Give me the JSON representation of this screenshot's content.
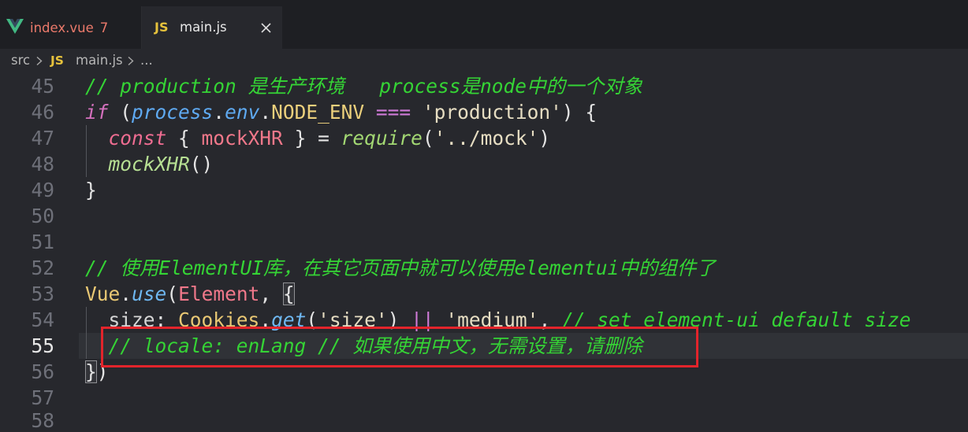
{
  "colors": {
    "editor_bg": "#27282d",
    "tab_bar_bg": "#1e1f23",
    "tab_error_text": "#ec7a6b",
    "js_icon": "#e6c23c",
    "vue_icon_primary": "#42b883",
    "vue_icon_secondary": "#35495e",
    "line_number": "#6e7079",
    "line_number_active": "#e6e6e6",
    "current_line_bg": "#303237",
    "indent_guide": "#54565c",
    "annotation_border": "#e3242b"
  },
  "tabs": [
    {
      "icon": "vue-icon",
      "label": "index.vue",
      "badge": "7"
    },
    {
      "icon": "js-icon",
      "icon_text": "JS",
      "label": "main.js",
      "close_icon": "close-icon"
    }
  ],
  "breadcrumb": {
    "separator_icon": "chevron-right-icon",
    "folder": "src",
    "file_icon": "JS",
    "file": "main.js",
    "more": "..."
  },
  "editor": {
    "lines": [
      {
        "number": "45",
        "tokens": [
          {
            "t": "// production 是生产环境   process是node中的一个对象",
            "c": "#35d435",
            "i": true
          }
        ]
      },
      {
        "number": "46",
        "tokens": [
          {
            "t": "if",
            "c": "#d470bd",
            "i": true
          },
          {
            "t": " (",
            "c": "#e4e4e4"
          },
          {
            "t": "process",
            "c": "#5faaf2",
            "i": true
          },
          {
            "t": ".",
            "c": "#e4e4e4"
          },
          {
            "t": "env",
            "c": "#5faaf2",
            "i": true
          },
          {
            "t": ".",
            "c": "#e4e4e4"
          },
          {
            "t": "NODE_ENV",
            "c": "#ecd07c"
          },
          {
            "t": " ",
            "c": "#e4e4e4"
          },
          {
            "t": "===",
            "c": "#d07bd8"
          },
          {
            "t": " ",
            "c": "#e4e4e4"
          },
          {
            "t": "'production'",
            "c": "#e6ddc2"
          },
          {
            "t": ") {",
            "c": "#e4e4e4"
          }
        ]
      },
      {
        "number": "47",
        "guide": true,
        "tokens": [
          {
            "t": "  ",
            "c": "#e4e4e4"
          },
          {
            "t": "const",
            "c": "#ef6d92",
            "i": true
          },
          {
            "t": " { ",
            "c": "#e4e4e4"
          },
          {
            "t": "mockXHR",
            "c": "#f0788a"
          },
          {
            "t": " } = ",
            "c": "#e4e4e4"
          },
          {
            "t": "require",
            "c": "#a3d873",
            "i": true
          },
          {
            "t": "(",
            "c": "#e4e4e4"
          },
          {
            "t": "'../mock'",
            "c": "#e6ddc2"
          },
          {
            "t": ")",
            "c": "#e4e4e4"
          }
        ]
      },
      {
        "number": "48",
        "guide": true,
        "tokens": [
          {
            "t": "  ",
            "c": "#e4e4e4"
          },
          {
            "t": "mockXHR",
            "c": "#b6df93",
            "i": true
          },
          {
            "t": "()",
            "c": "#e4e4e4"
          }
        ]
      },
      {
        "number": "49",
        "tokens": [
          {
            "t": "}",
            "c": "#e4e4e4"
          }
        ]
      },
      {
        "number": "50",
        "tokens": []
      },
      {
        "number": "51",
        "tokens": []
      },
      {
        "number": "52",
        "tokens": [
          {
            "t": "// 使用ElementUI库，在其它页面中就可以使用elementui中的组件了",
            "c": "#35d435",
            "i": true
          }
        ]
      },
      {
        "number": "53",
        "tokens": [
          {
            "t": "Vue",
            "c": "#e9c874"
          },
          {
            "t": ".",
            "c": "#e4e4e4"
          },
          {
            "t": "use",
            "c": "#6fb8f2",
            "i": true
          },
          {
            "t": "(",
            "c": "#e4e4e4"
          },
          {
            "t": "Element",
            "c": "#f0788a"
          },
          {
            "t": ", ",
            "c": "#e4e4e4"
          },
          {
            "t": "{",
            "c": "#e4e4e4",
            "m": true
          }
        ]
      },
      {
        "number": "54",
        "guide": true,
        "tokens": [
          {
            "t": "  ",
            "c": "#e4e4e4"
          },
          {
            "t": "size",
            "c": "#d6d6d6"
          },
          {
            "t": ": ",
            "c": "#e4e4e4"
          },
          {
            "t": "Cookies",
            "c": "#e9c874"
          },
          {
            "t": ".",
            "c": "#e4e4e4"
          },
          {
            "t": "get",
            "c": "#6fb8f2",
            "i": true
          },
          {
            "t": "(",
            "c": "#e4e4e4"
          },
          {
            "t": "'size'",
            "c": "#e6ddc2"
          },
          {
            "t": ") ",
            "c": "#e4e4e4"
          },
          {
            "t": "||",
            "c": "#d07bd8"
          },
          {
            "t": " ",
            "c": "#e4e4e4"
          },
          {
            "t": "'medium'",
            "c": "#e6ddc2"
          },
          {
            "t": ", ",
            "c": "#e4e4e4"
          },
          {
            "t": "// set element-ui default size",
            "c": "#35d435",
            "i": true
          }
        ]
      },
      {
        "number": "55",
        "guide": true,
        "current": true,
        "tokens": [
          {
            "t": "  ",
            "c": "#e4e4e4"
          },
          {
            "t": "// locale: enLang // 如果使用中文，无需设置，请删除",
            "c": "#35d435",
            "i": true
          }
        ]
      },
      {
        "number": "56",
        "tokens": [
          {
            "t": "}",
            "c": "#e4e4e4",
            "m": true
          },
          {
            "t": ")",
            "c": "#e4e4e4"
          }
        ]
      },
      {
        "number": "57",
        "tokens": []
      },
      {
        "number": "58",
        "tokens": []
      }
    ]
  }
}
